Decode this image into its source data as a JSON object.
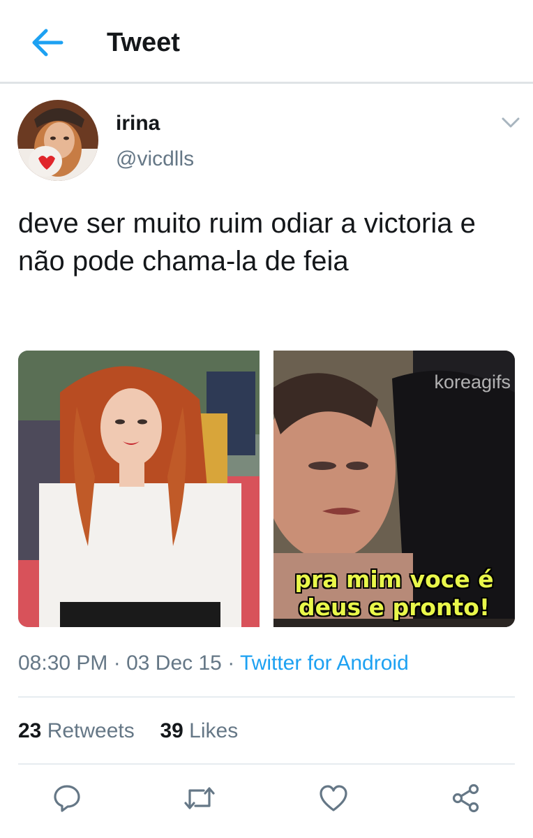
{
  "header": {
    "title": "Tweet",
    "back_icon": "back-arrow-icon"
  },
  "tweet": {
    "display_name": "irina",
    "handle": "@vicdlls",
    "text": "deve ser muito ruim odiar a victoria e não pode chama-la de feia",
    "media": [
      {
        "name": "photo-red-carpet"
      },
      {
        "name": "gif-meme",
        "watermark": "koreagifs",
        "caption_line1": "pra mim voce é",
        "caption_line2": "deus e pronto!"
      }
    ],
    "time": "08:30 PM",
    "sep1": " · ",
    "date": "03 Dec 15",
    "sep2": " · ",
    "source": "Twitter for Android",
    "retweets_count": "23",
    "retweets_label": " Retweets",
    "likes_count": "39",
    "likes_label": " Likes"
  },
  "actions": [
    "reply-icon",
    "retweet-icon",
    "like-icon",
    "share-icon"
  ],
  "colors": {
    "accent": "#1da1f2",
    "secondary_text": "#657786",
    "primary_text": "#14171a",
    "divider": "#e6ecf0"
  }
}
